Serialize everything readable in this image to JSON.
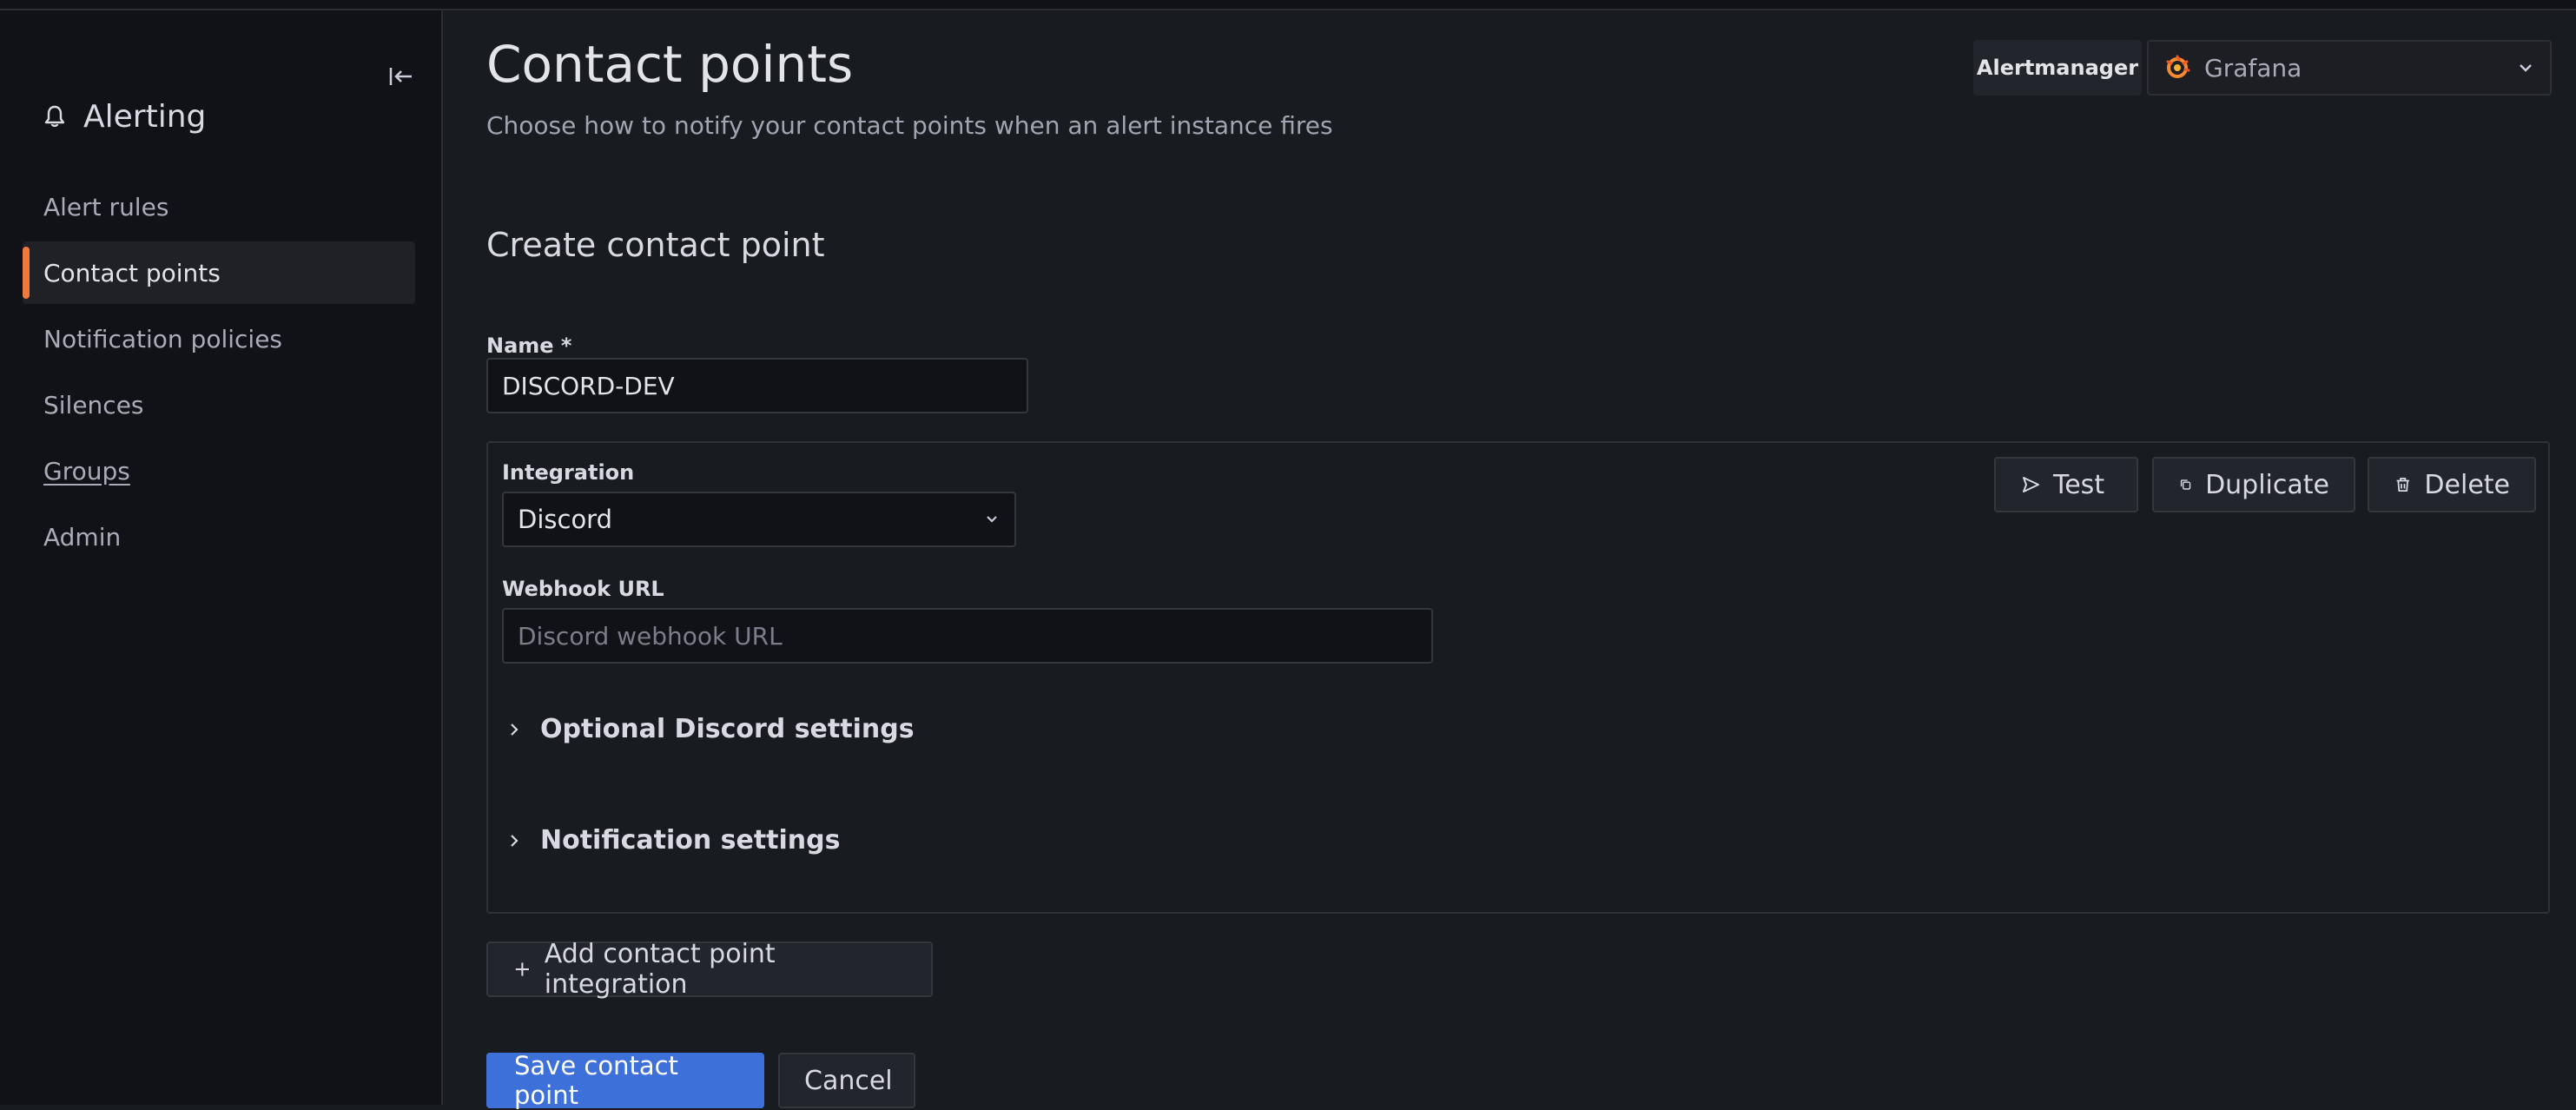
{
  "sidebar": {
    "section_title": "Alerting",
    "items": [
      {
        "label": "Alert rules"
      },
      {
        "label": "Contact points"
      },
      {
        "label": "Notification policies"
      },
      {
        "label": "Silences"
      },
      {
        "label": "Groups"
      },
      {
        "label": "Admin"
      }
    ],
    "active_index": 1,
    "accent_color": "#f0793d"
  },
  "header": {
    "title": "Contact points",
    "subtitle": "Choose how to notify your contact points when an alert instance fires",
    "alertmanager_label": "Alertmanager",
    "alertmanager_value": "Grafana"
  },
  "form": {
    "title": "Create contact point",
    "name_label": "Name *",
    "name_value": "DISCORD-DEV",
    "integration": {
      "label": "Integration",
      "value": "Discord",
      "webhook_label": "Webhook URL",
      "webhook_placeholder": "Discord webhook URL",
      "test_label": "Test",
      "duplicate_label": "Duplicate",
      "delete_label": "Delete",
      "optional_settings_label": "Optional Discord settings",
      "notification_settings_label": "Notification settings"
    },
    "add_integration_label": "Add contact point integration",
    "save_label": "Save contact point",
    "cancel_label": "Cancel"
  },
  "colors": {
    "primary": "#3d71d9",
    "background": "#181b1f",
    "sidebar": "#111217"
  }
}
